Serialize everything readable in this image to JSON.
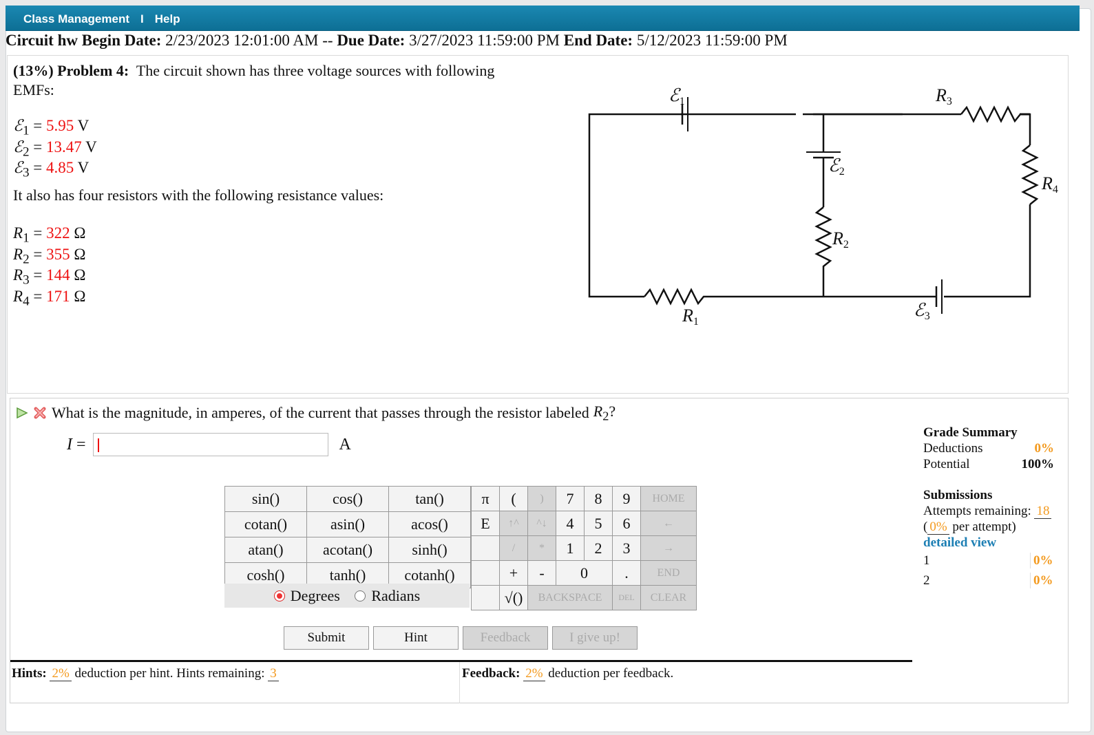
{
  "nav": {
    "class_management": "Class Management",
    "separator": "I",
    "help": "Help"
  },
  "assignment": {
    "name": "Circuit hw",
    "begin_label": "Begin Date:",
    "begin": "2/23/2023 12:01:00 AM",
    "sep": "--",
    "due_label": "Due Date:",
    "due": "3/27/2023 11:59:00 PM",
    "end_label": "End Date:",
    "end": "5/12/2023 11:59:00 PM"
  },
  "problem": {
    "weight": "(13%)",
    "title": "Problem 4:",
    "intro": "The circuit shown has three voltage sources with following EMFs:",
    "emfs": [
      {
        "sym": "ℰ",
        "sub": "1",
        "value": "5.95",
        "unit": "V"
      },
      {
        "sym": "ℰ",
        "sub": "2",
        "value": "13.47",
        "unit": "V"
      },
      {
        "sym": "ℰ",
        "sub": "3",
        "value": "4.85",
        "unit": "V"
      }
    ],
    "resistor_intro": "It also has four resistors with the following resistance values:",
    "resistors": [
      {
        "sym": "R",
        "sub": "1",
        "value": "322",
        "unit": "Ω"
      },
      {
        "sym": "R",
        "sub": "2",
        "value": "355",
        "unit": "Ω"
      },
      {
        "sym": "R",
        "sub": "3",
        "value": "144",
        "unit": "Ω"
      },
      {
        "sym": "R",
        "sub": "4",
        "value": "171",
        "unit": "Ω"
      }
    ],
    "circuit_labels": {
      "e1": "ℰ",
      "e1s": "1",
      "e2": "ℰ",
      "e2s": "2",
      "e3": "ℰ",
      "e3s": "3",
      "r1": "R",
      "r1s": "1",
      "r2": "R",
      "r2s": "2",
      "r3": "R",
      "r3s": "3",
      "r4": "R",
      "r4s": "4"
    }
  },
  "question": {
    "text": "What is the magnitude, in amperes, of the current that passes through the resistor labeled",
    "resistor": "R",
    "resistor_sub": "2",
    "qmark": "?",
    "var": "I",
    "eq": "=",
    "value": "",
    "unit": "A"
  },
  "functions": [
    [
      "sin()",
      "cos()",
      "tan()"
    ],
    [
      "cotan()",
      "asin()",
      "acos()"
    ],
    [
      "atan()",
      "acotan()",
      "sinh()"
    ],
    [
      "cosh()",
      "tanh()",
      "cotanh()"
    ]
  ],
  "angle": {
    "degrees": "Degrees",
    "radians": "Radians",
    "selected": "Degrees"
  },
  "keys": {
    "pi": "π",
    "lparen": "(",
    "rparen": ")",
    "k7": "7",
    "k8": "8",
    "k9": "9",
    "home": "HOME",
    "e": "E",
    "up": "↑^",
    "down": "^↓",
    "k4": "4",
    "k5": "5",
    "k6": "6",
    "left": "←",
    "div": "/",
    "mul": "*",
    "k1": "1",
    "k2": "2",
    "k3": "3",
    "right": "→",
    "plus": "+",
    "minus": "-",
    "k0": "0",
    "dot": ".",
    "end": "END",
    "sqrt": "√()",
    "backspace": "BACKSPACE",
    "del": "DEL",
    "clear": "CLEAR"
  },
  "buttons": {
    "submit": "Submit",
    "hint": "Hint",
    "feedback": "Feedback",
    "giveup": "I give up!"
  },
  "hints": {
    "label": "Hints:",
    "pct": "2%",
    "text": "deduction per hint. Hints remaining:",
    "remaining": "3"
  },
  "feedback": {
    "label": "Feedback:",
    "pct": "2%",
    "text": "deduction per feedback."
  },
  "grade": {
    "title": "Grade Summary",
    "deductions_label": "Deductions",
    "deductions": "0%",
    "potential_label": "Potential",
    "potential": "100%"
  },
  "submissions": {
    "title": "Submissions",
    "attempts_label": "Attempts remaining:",
    "attempts": "18",
    "per_open": "(",
    "per_pct": "0%",
    "per_text": "per attempt)",
    "detailed": "detailed view",
    "rows": [
      {
        "n": "1",
        "pct": "0%"
      },
      {
        "n": "2",
        "pct": "0%"
      }
    ]
  }
}
